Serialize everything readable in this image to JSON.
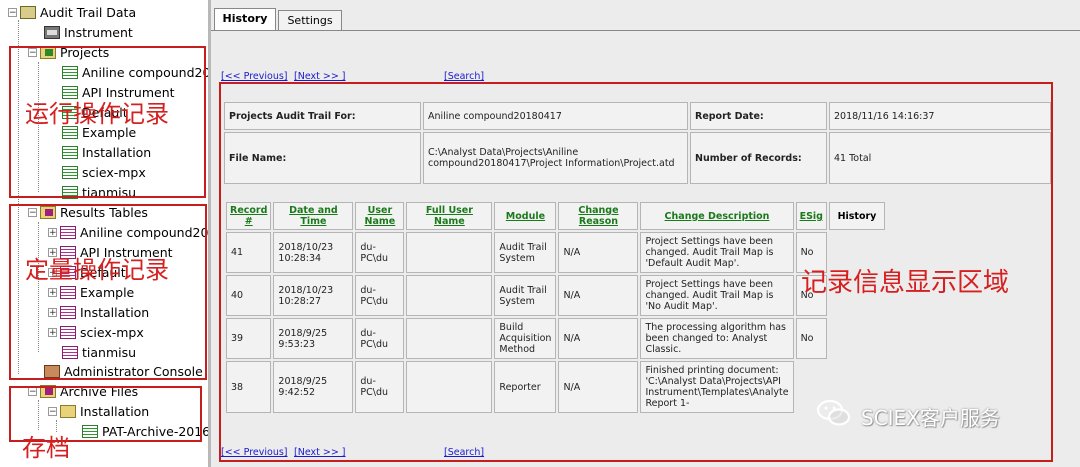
{
  "tree": {
    "root": "Audit Trail Data",
    "instrument": "Instrument",
    "projects": {
      "label": "Projects",
      "items": [
        "Aniline compound20",
        "API Instrument",
        "Default",
        "Example",
        "Installation",
        "sciex-mpx",
        "tianmisu"
      ]
    },
    "results": {
      "label": "Results Tables",
      "items": [
        "Aniline compound20",
        "API Instrument",
        "Default",
        "Example",
        "Installation",
        "sciex-mpx",
        "tianmisu"
      ]
    },
    "admin_console": "Administrator Console",
    "archive": {
      "label": "Archive Files",
      "installation": "Installation",
      "file": "PAT-Archive-2016"
    }
  },
  "annotations": {
    "run_ops": "运行操作记录",
    "quant_ops": "定量操作记录",
    "archive": "存档",
    "display_area": "记录信息显示区域"
  },
  "watermark": "SCIEX客户服务",
  "tabs": [
    {
      "label": "History",
      "active": true
    },
    {
      "label": "Settings",
      "active": false
    }
  ],
  "nav": {
    "previous": "[<< Previous]",
    "next": "[Next >> ]",
    "search": "[Search]"
  },
  "report_header": {
    "project_label": "Projects Audit Trail For:",
    "project_value": "Aniline compound20180417",
    "report_date_label": "Report Date:",
    "report_date_value": "2018/11/16 14:16:37",
    "file_name_label": "File Name:",
    "file_name_value": "C:\\Analyst Data\\Projects\\Aniline compound20180417\\Project Information\\Project.atd",
    "num_records_label": "Number of Records:",
    "num_records_value": "41 Total"
  },
  "grid": {
    "columns": [
      "Record #",
      "Date and Time",
      "User Name",
      "Full User Name",
      "Module",
      "Change Reason",
      "Change Description",
      "ESig",
      "History"
    ],
    "rows": [
      {
        "record": "41",
        "datetime": "2018/10/23 10:28:34",
        "user": "du-PC\\du",
        "full_user": "",
        "module": "Audit Trail System",
        "reason": "N/A",
        "description": "Project Settings have been changed. Audit Trail Map is 'Default Audit Map'.",
        "esig": "No"
      },
      {
        "record": "40",
        "datetime": "2018/10/23 10:28:27",
        "user": "du-PC\\du",
        "full_user": "",
        "module": "Audit Trail System",
        "reason": "N/A",
        "description": "Project Settings have been changed. Audit Trail Map is 'No Audit Map'.",
        "esig": "No"
      },
      {
        "record": "39",
        "datetime": "2018/9/25 9:53:23",
        "user": "du-PC\\du",
        "full_user": "",
        "module": "Build Acquisition Method",
        "reason": "N/A",
        "description": "The processing algorithm has been changed to: Analyst Classic.",
        "esig": "No"
      },
      {
        "record": "38",
        "datetime": "2018/9/25 9:42:52",
        "user": "du-PC\\du",
        "full_user": "",
        "module": "Reporter",
        "reason": "N/A",
        "description": "Finished printing document: 'C:\\Analyst Data\\Projects\\API Instrument\\Templates\\Analyte Report 1-",
        "esig": ""
      }
    ]
  }
}
